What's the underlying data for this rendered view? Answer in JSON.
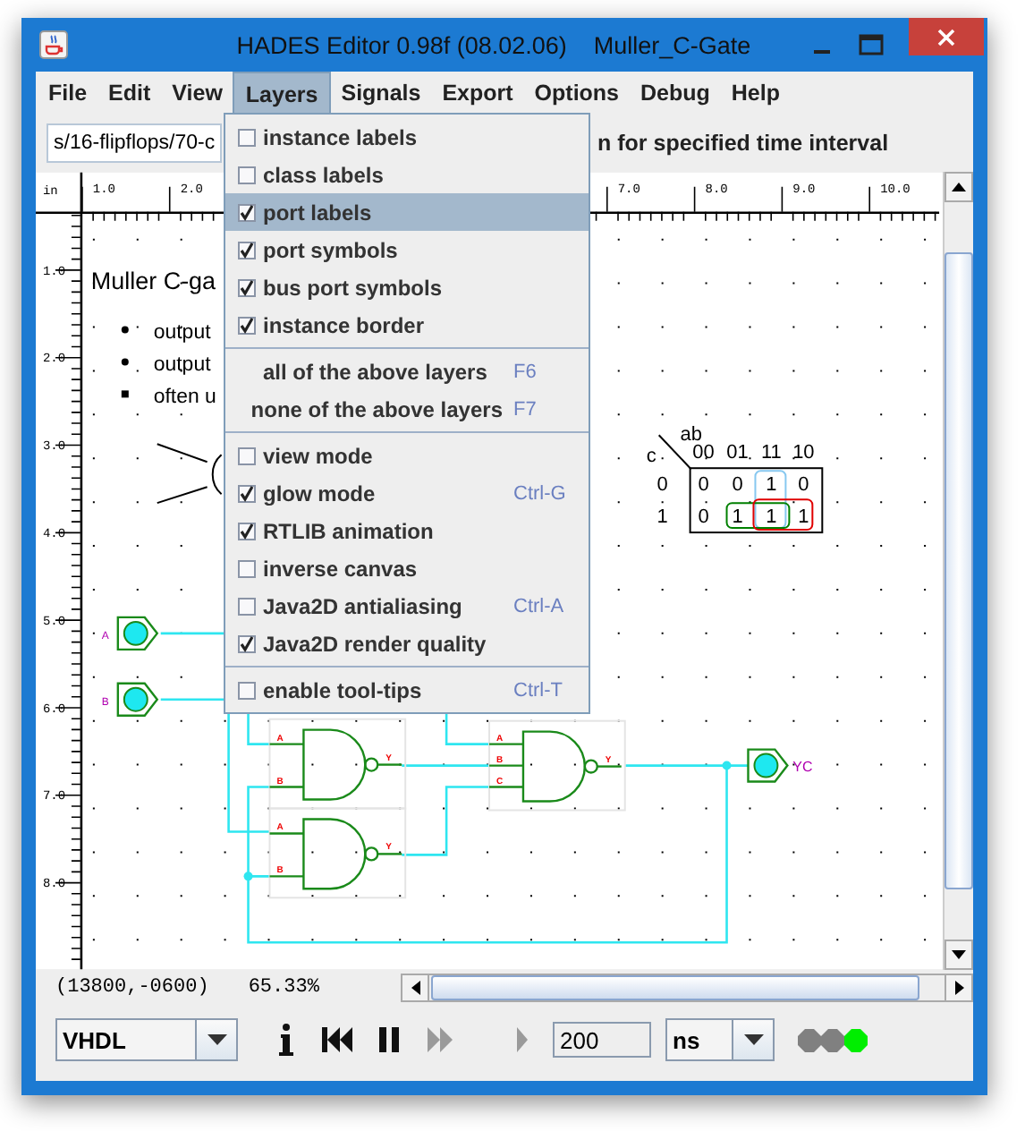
{
  "window": {
    "title": "HADES Editor 0.98f (08.02.06)    Muller_C-Gate"
  },
  "menus": [
    {
      "label": "File",
      "selected": false
    },
    {
      "label": "Edit",
      "selected": false
    },
    {
      "label": "View",
      "selected": false
    },
    {
      "label": "Layers",
      "selected": true
    },
    {
      "label": "Signals",
      "selected": false
    },
    {
      "label": "Export",
      "selected": false
    },
    {
      "label": "Options",
      "selected": false
    },
    {
      "label": "Debug",
      "selected": false
    },
    {
      "label": "Help",
      "selected": false
    }
  ],
  "toolbar": {
    "path": "s/16-flipflops/70-c",
    "hint": "n for specified time interval"
  },
  "layers_menu": {
    "items": [
      {
        "kind": "check",
        "label": "instance labels",
        "checked": false,
        "selected": false
      },
      {
        "kind": "check",
        "label": "class labels",
        "checked": false,
        "selected": false
      },
      {
        "kind": "check",
        "label": "port labels",
        "checked": true,
        "selected": true
      },
      {
        "kind": "check",
        "label": "port symbols",
        "checked": true,
        "selected": false
      },
      {
        "kind": "check",
        "label": "bus port symbols",
        "checked": true,
        "selected": false
      },
      {
        "kind": "check",
        "label": "instance border",
        "checked": true,
        "selected": false
      },
      {
        "kind": "separator"
      },
      {
        "kind": "action",
        "label": "all of the above layers",
        "shortcut": "F6",
        "selected": false
      },
      {
        "kind": "action",
        "label": "none of the above layers",
        "shortcut": "F7",
        "selected": false
      },
      {
        "kind": "separator"
      },
      {
        "kind": "check",
        "label": "view mode",
        "checked": false,
        "selected": false
      },
      {
        "kind": "check",
        "label": "glow mode",
        "checked": true,
        "shortcut": "Ctrl-G",
        "selected": false
      },
      {
        "kind": "check",
        "label": "RTLIB animation",
        "checked": true,
        "selected": false
      },
      {
        "kind": "check",
        "label": "inverse canvas",
        "checked": false,
        "selected": false
      },
      {
        "kind": "check",
        "label": "Java2D antialiasing",
        "checked": false,
        "shortcut": "Ctrl-A",
        "selected": false
      },
      {
        "kind": "check",
        "label": "Java2D render quality",
        "checked": true,
        "selected": false
      },
      {
        "kind": "separator"
      },
      {
        "kind": "check",
        "label": "enable tool-tips",
        "checked": false,
        "shortcut": "Ctrl-T",
        "selected": false
      }
    ]
  },
  "ruler": {
    "unit": "in",
    "x_labels": [
      "1.0",
      "2.0",
      "7.0",
      "8.0",
      "9.0",
      "10.0"
    ],
    "y_labels": [
      "1.0",
      "2.0",
      "3.0",
      "4.0",
      "5.0",
      "6.0",
      "7.0",
      "8.0"
    ]
  },
  "canvas": {
    "heading": "Muller C-ga",
    "bullets": [
      "output",
      "output",
      "often u"
    ],
    "kmap": {
      "row_var": "c",
      "col_var": "ab",
      "columns": [
        "00",
        "01",
        "11",
        "10"
      ],
      "rows": [
        {
          "label": "0",
          "cells": [
            "0",
            "0",
            "1",
            "0"
          ]
        },
        {
          "label": "1",
          "cells": [
            "0",
            "1",
            "1",
            "1"
          ]
        }
      ],
      "loops": [
        {
          "color": "#87c8f0"
        },
        {
          "color": "#008000"
        },
        {
          "color": "#e00000"
        }
      ]
    },
    "ports": [
      {
        "label": "A"
      },
      {
        "label": "B"
      },
      {
        "label": "YC"
      }
    ],
    "gates": [
      {
        "inputs": [
          "A",
          "B"
        ],
        "output": "Y"
      },
      {
        "inputs": [
          "A",
          "B"
        ],
        "output": "Y"
      },
      {
        "inputs": [
          "A",
          "B",
          "C"
        ],
        "output": "Y"
      }
    ]
  },
  "status": {
    "coords": "(13800,-0600)",
    "zoom": "65.33%"
  },
  "controls": {
    "language": "VHDL",
    "time": "200",
    "unit": "ns",
    "buttons": [
      {
        "kind": "info",
        "disabled": false
      },
      {
        "kind": "rewind",
        "disabled": false
      },
      {
        "kind": "pause",
        "disabled": false
      },
      {
        "kind": "fast-forward",
        "disabled": true
      },
      {
        "kind": "play",
        "disabled": true
      }
    ],
    "leds": [
      {
        "color": "#808080"
      },
      {
        "color": "#808080"
      },
      {
        "color": "#00ee00"
      }
    ]
  }
}
